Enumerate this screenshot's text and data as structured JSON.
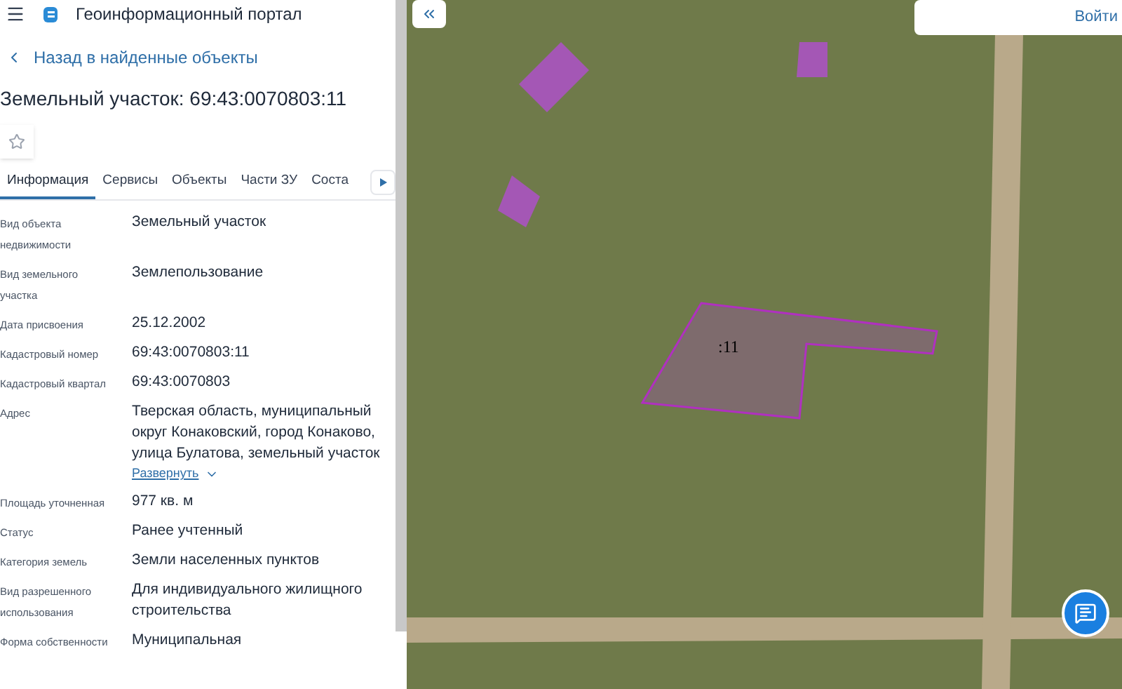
{
  "header": {
    "title": "Геоинформационный портал"
  },
  "back_link": "Назад в найденные объекты",
  "object_title": "Земельный участок: 69:43:0070803:11",
  "favorite": {
    "on": false
  },
  "tabs": [
    {
      "label": "Информация",
      "selected": true
    },
    {
      "label": "Сервисы",
      "selected": false
    },
    {
      "label": "Объекты",
      "selected": false
    },
    {
      "label": "Части ЗУ",
      "selected": false
    },
    {
      "label": "Соста",
      "selected": false
    }
  ],
  "properties": [
    {
      "label": "Вид объекта недвижимости",
      "value": "Земельный участок"
    },
    {
      "label": "Вид земельного участка",
      "value": "Землепользование"
    },
    {
      "label": "Дата присвоения",
      "value": "25.12.2002"
    },
    {
      "label": "Кадастровый номер",
      "value": "69:43:0070803:11"
    },
    {
      "label": "Кадастровый квартал",
      "value": "69:43:0070803"
    },
    {
      "label": "Адрес",
      "value": "Тверская область, муниципальный округ Конаковский, город Конаково, улица Булатова, земельный участок",
      "expand_link": "Развернуть"
    },
    {
      "label": "Площадь уточненная",
      "value": "977 кв. м"
    },
    {
      "label": "Статус",
      "value": "Ранее учтенный"
    },
    {
      "label": "Категория земель",
      "value": "Земли населенных пунктов"
    },
    {
      "label": "Вид разрешенного использования",
      "value": "Для индивидуального жилищного строительства"
    },
    {
      "label": "Форма собственности",
      "value": "Муниципальная"
    }
  ],
  "map": {
    "parcel_label": ":11",
    "login_button": "Войти"
  }
}
